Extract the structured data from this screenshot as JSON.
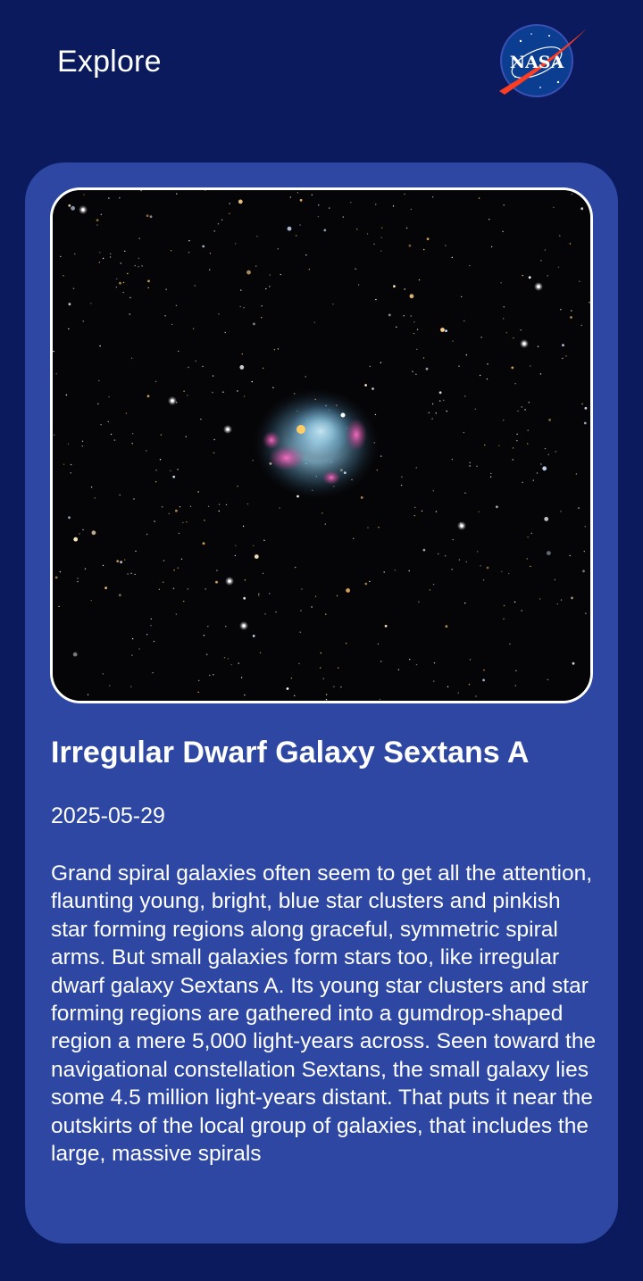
{
  "header": {
    "title": "Explore",
    "logo_text": "NASA"
  },
  "apod": {
    "title": "Irregular Dwarf Galaxy Sextans A",
    "date": "2025-05-29",
    "explanation": "Grand spiral galaxies often seem to get all the attention, flaunting young, bright, blue star clusters and pinkish star forming regions along graceful, symmetric spiral arms. But small galaxies form stars too, like irregular dwarf galaxy Sextans A. Its young star clusters and star forming regions are gathered into a gumdrop-shaped region a mere 5,000 light-years across. Seen toward the navigational constellation Sextans, the small galaxy lies some 4.5 million light-years distant. That puts it near the outskirts of the local group of galaxies, that includes the large, massive spirals"
  },
  "colors": {
    "background": "#0a1a5c",
    "card": "#2d47a3",
    "text": "#ffffff",
    "logo_blue": "#0b3d91",
    "logo_red": "#fc3d21"
  }
}
